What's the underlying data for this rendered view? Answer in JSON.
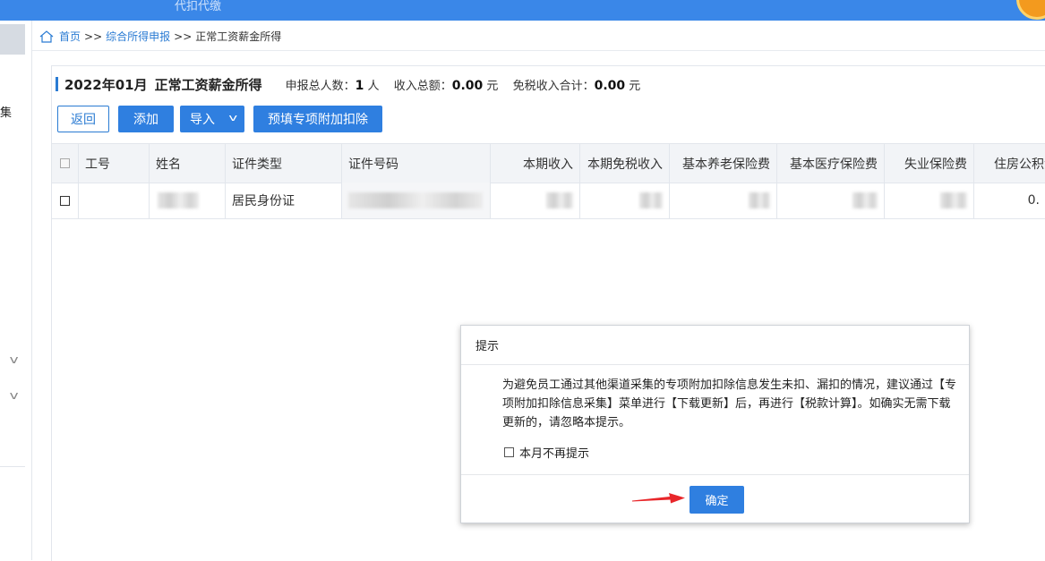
{
  "topbar": {
    "title": "代扣代缴"
  },
  "sidebar": {
    "clipped_label": "集"
  },
  "breadcrumb": {
    "home": "首页",
    "sep": ">>",
    "level2": "综合所得申报",
    "current": "正常工资薪金所得"
  },
  "page": {
    "period": "2022年01月",
    "title": "正常工资薪金所得",
    "stats": {
      "total_people_label": "申报总人数：",
      "total_people_value": "1",
      "total_people_unit": "人",
      "total_income_label": "收入总额：",
      "total_income_value": "0.00",
      "total_income_unit": "元",
      "exempt_label": "免税收入合计：",
      "exempt_value": "0.00",
      "exempt_unit": "元"
    }
  },
  "toolbar": {
    "back": "返回",
    "add": "添加",
    "import": "导入",
    "prefill": "预填专项附加扣除"
  },
  "table": {
    "headers": [
      "工号",
      "姓名",
      "证件类型",
      "证件号码",
      "本期收入",
      "本期免税收入",
      "基本养老保险费",
      "基本医疗保险费",
      "失业保险费",
      "住房公积金"
    ],
    "row": {
      "id_type": "居民身份证",
      "housing_fund_partial": "0."
    }
  },
  "dialog": {
    "title": "提示",
    "message": "为避免员工通过其他渠道采集的专项附加扣除信息发生未扣、漏扣的情况，建议通过【专项附加扣除信息采集】菜单进行【下载更新】后，再进行【税款计算】。如确实无需下载更新的，请忽略本提示。",
    "checkbox_label": "本月不再提示",
    "ok": "确定"
  },
  "colors": {
    "primary": "#2f7fe0",
    "topbar": "#3a87e8",
    "arrow": "#e8262a"
  },
  "icons": {
    "home": "home-icon",
    "caret": "chevron-down-icon",
    "arrow": "red-arrow-icon"
  }
}
